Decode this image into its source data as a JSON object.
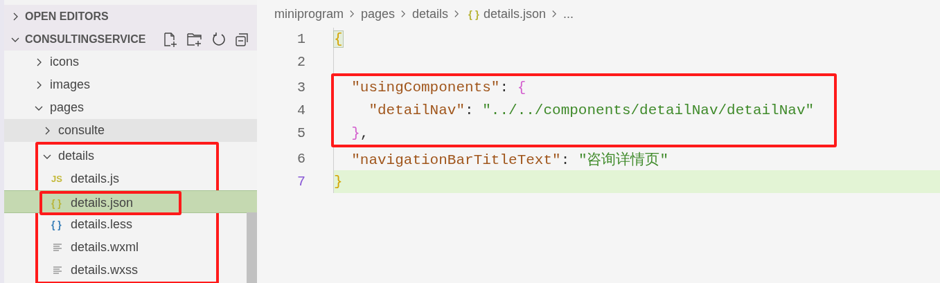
{
  "sidebar": {
    "sections": [
      {
        "label": "OPEN EDITORS",
        "expanded": false,
        "toolbar": false
      },
      {
        "label": "CONSULTINGSERVICE",
        "expanded": true,
        "toolbar": true
      }
    ],
    "tree": [
      {
        "label": "icons",
        "kind": "folder",
        "expanded": false,
        "selected": false,
        "hovered": false,
        "boxed": false
      },
      {
        "label": "images",
        "kind": "folder",
        "expanded": false,
        "selected": false,
        "hovered": false,
        "boxed": false
      },
      {
        "label": "pages",
        "kind": "folder",
        "expanded": true,
        "selected": false,
        "hovered": false,
        "boxed": false,
        "children": [
          {
            "label": "consulte",
            "kind": "folder",
            "expanded": false,
            "selected": false,
            "hovered": true,
            "boxed": false
          },
          {
            "label": "details",
            "kind": "folder",
            "expanded": true,
            "selected": false,
            "hovered": false,
            "boxed": true,
            "children": [
              {
                "label": "details.js",
                "kind": "js",
                "icon": "JS",
                "selected": false,
                "hovered": false,
                "boxed": false
              },
              {
                "label": "details.json",
                "kind": "json",
                "icon": "{ }",
                "selected": true,
                "hovered": false,
                "boxed": true
              },
              {
                "label": "details.less",
                "kind": "less",
                "icon": "{ }",
                "selected": false,
                "hovered": false,
                "boxed": false
              },
              {
                "label": "details.wxml",
                "kind": "text",
                "selected": false,
                "hovered": false,
                "boxed": false
              },
              {
                "label": "details.wxss",
                "kind": "text",
                "selected": false,
                "hovered": false,
                "boxed": false
              }
            ]
          }
        ]
      }
    ]
  },
  "breadcrumb": [
    {
      "label": "miniprogram",
      "kind": "text"
    },
    {
      "label": "pages",
      "kind": "text"
    },
    {
      "label": "details",
      "kind": "text"
    },
    {
      "label": "details.json",
      "kind": "json",
      "icon": "{ }"
    },
    {
      "label": "...",
      "kind": "text"
    }
  ],
  "editor": {
    "blocks": [
      {
        "boxed": false,
        "lines": [
          {
            "number": "1",
            "current": false,
            "tokens": [
              {
                "kind": "brace-outer",
                "text": "{",
                "matched": true
              }
            ]
          },
          {
            "number": "2",
            "current": false
          }
        ]
      },
      {
        "boxed": true,
        "lines": [
          {
            "number": "3",
            "current": false,
            "tokens": [
              {
                "kind": "key",
                "text": "  \"usingComponents\""
              },
              {
                "kind": "punct",
                "text": ": "
              },
              {
                "kind": "brace-inner",
                "text": "{"
              }
            ]
          },
          {
            "number": "4",
            "current": false,
            "tokens": [
              {
                "kind": "key",
                "text": "    \"detailNav\""
              },
              {
                "kind": "punct",
                "text": ": "
              },
              {
                "kind": "string",
                "text": "\"../../components/detailNav/detailNav\""
              }
            ]
          },
          {
            "number": "5",
            "current": false,
            "tokens": [
              {
                "kind": "brace-inner",
                "text": "  }"
              },
              {
                "kind": "punct",
                "text": ","
              }
            ]
          }
        ]
      },
      {
        "boxed": false,
        "lines": [
          {
            "number": "6",
            "current": false,
            "tokens": [
              {
                "kind": "key",
                "text": "  \"navigationBarTitleText\""
              },
              {
                "kind": "punct",
                "text": ": "
              },
              {
                "kind": "string",
                "text": "\"咨询详情页\""
              }
            ]
          },
          {
            "number": "7",
            "current": true,
            "tokens": [
              {
                "kind": "brace-outer",
                "text": "}",
                "matched": false
              }
            ]
          }
        ]
      }
    ]
  }
}
